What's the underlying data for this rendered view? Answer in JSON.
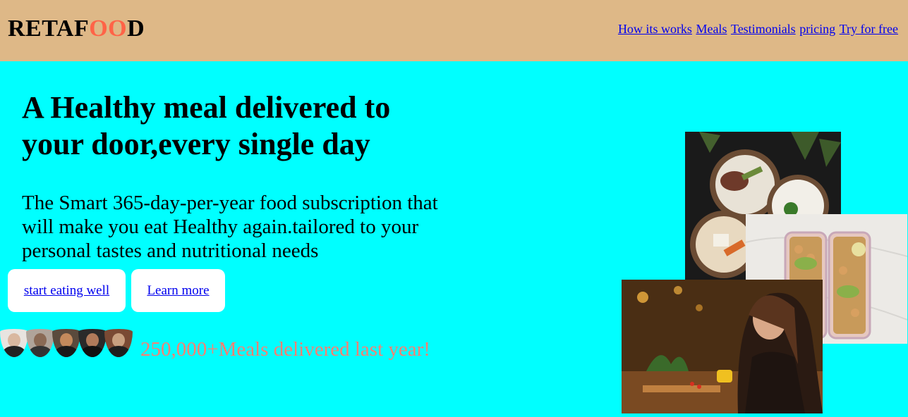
{
  "header": {
    "logo_part1": "RETAF",
    "logo_part2": "OO",
    "logo_part3": "D",
    "nav": [
      "How its works",
      "Meals",
      "Testimonials",
      "pricing",
      "Try for free"
    ]
  },
  "hero": {
    "headline": "A Healthy meal delivered to your door,every single day",
    "subtitle": "The Smart 365-day-per-year food subscription that will make you eat Healthy again.tailored to your personal tastes and nutritional needs",
    "primary_button": "start eating well",
    "secondary_button": "Learn more",
    "delivered_text": "250,000+Meals delivered last year!"
  },
  "colors": {
    "header_bg": "#deb887",
    "hero_bg": "#00ffff",
    "accent": "#ff6347",
    "delivered": "#fa8072"
  }
}
